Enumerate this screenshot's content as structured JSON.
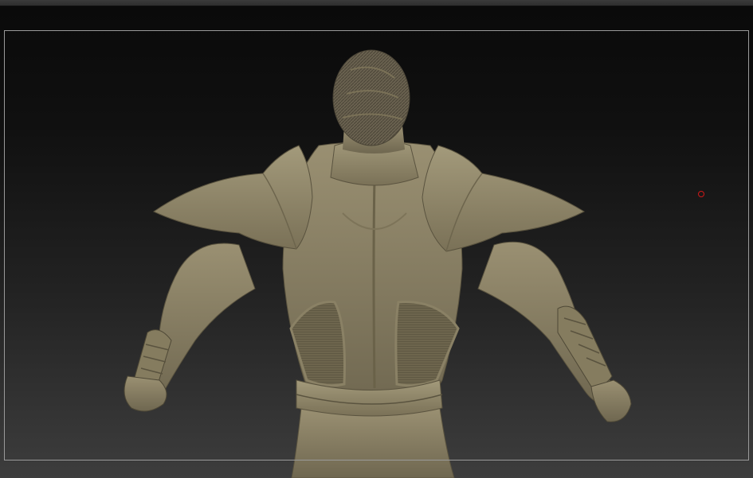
{
  "app": {
    "accent_color": "#d01818",
    "model_color": "#8f8566"
  },
  "viewport": {
    "frame_color": "#9a9a9a",
    "cursor": {
      "icon": "brush-cursor-icon"
    }
  }
}
